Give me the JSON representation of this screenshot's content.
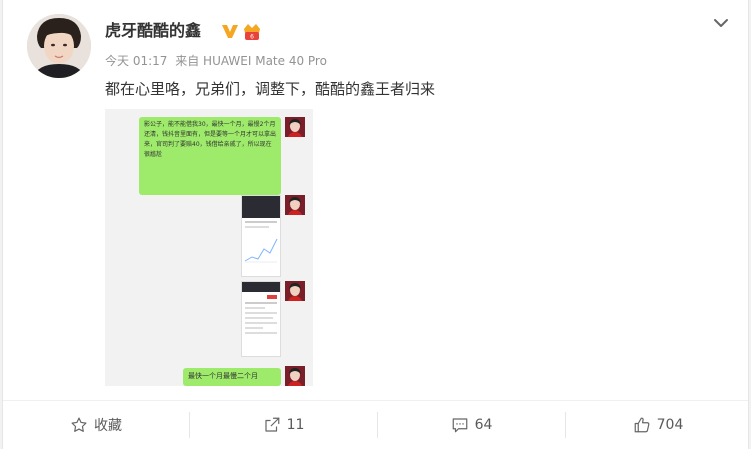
{
  "post": {
    "username": "虎牙酷酷的鑫",
    "time": "今天 01:17",
    "source": "来自 HUAWEI Mate 40 Pro",
    "text": "都在心里咯，兄弟们，调整下，酷酷的鑫王者归来"
  },
  "image": {
    "bubble_1": "影公子，能不能借我30，最快一个月，最慢2个月还清，钱抖音里面有，但是要等一个月才可以拿出来，官司判了要赔40，钱借给亲戚了，所以现在很尴尬",
    "bubble_2": "最快一个月最慢二个月"
  },
  "actions": {
    "favorite_label": "收藏",
    "repost_count": "11",
    "comment_count": "64",
    "like_count": "704"
  },
  "colors": {
    "bubble_green": "#9eea6a",
    "verified_gold": "#f5a623",
    "text_dark": "#333333",
    "text_gray": "#939393"
  }
}
